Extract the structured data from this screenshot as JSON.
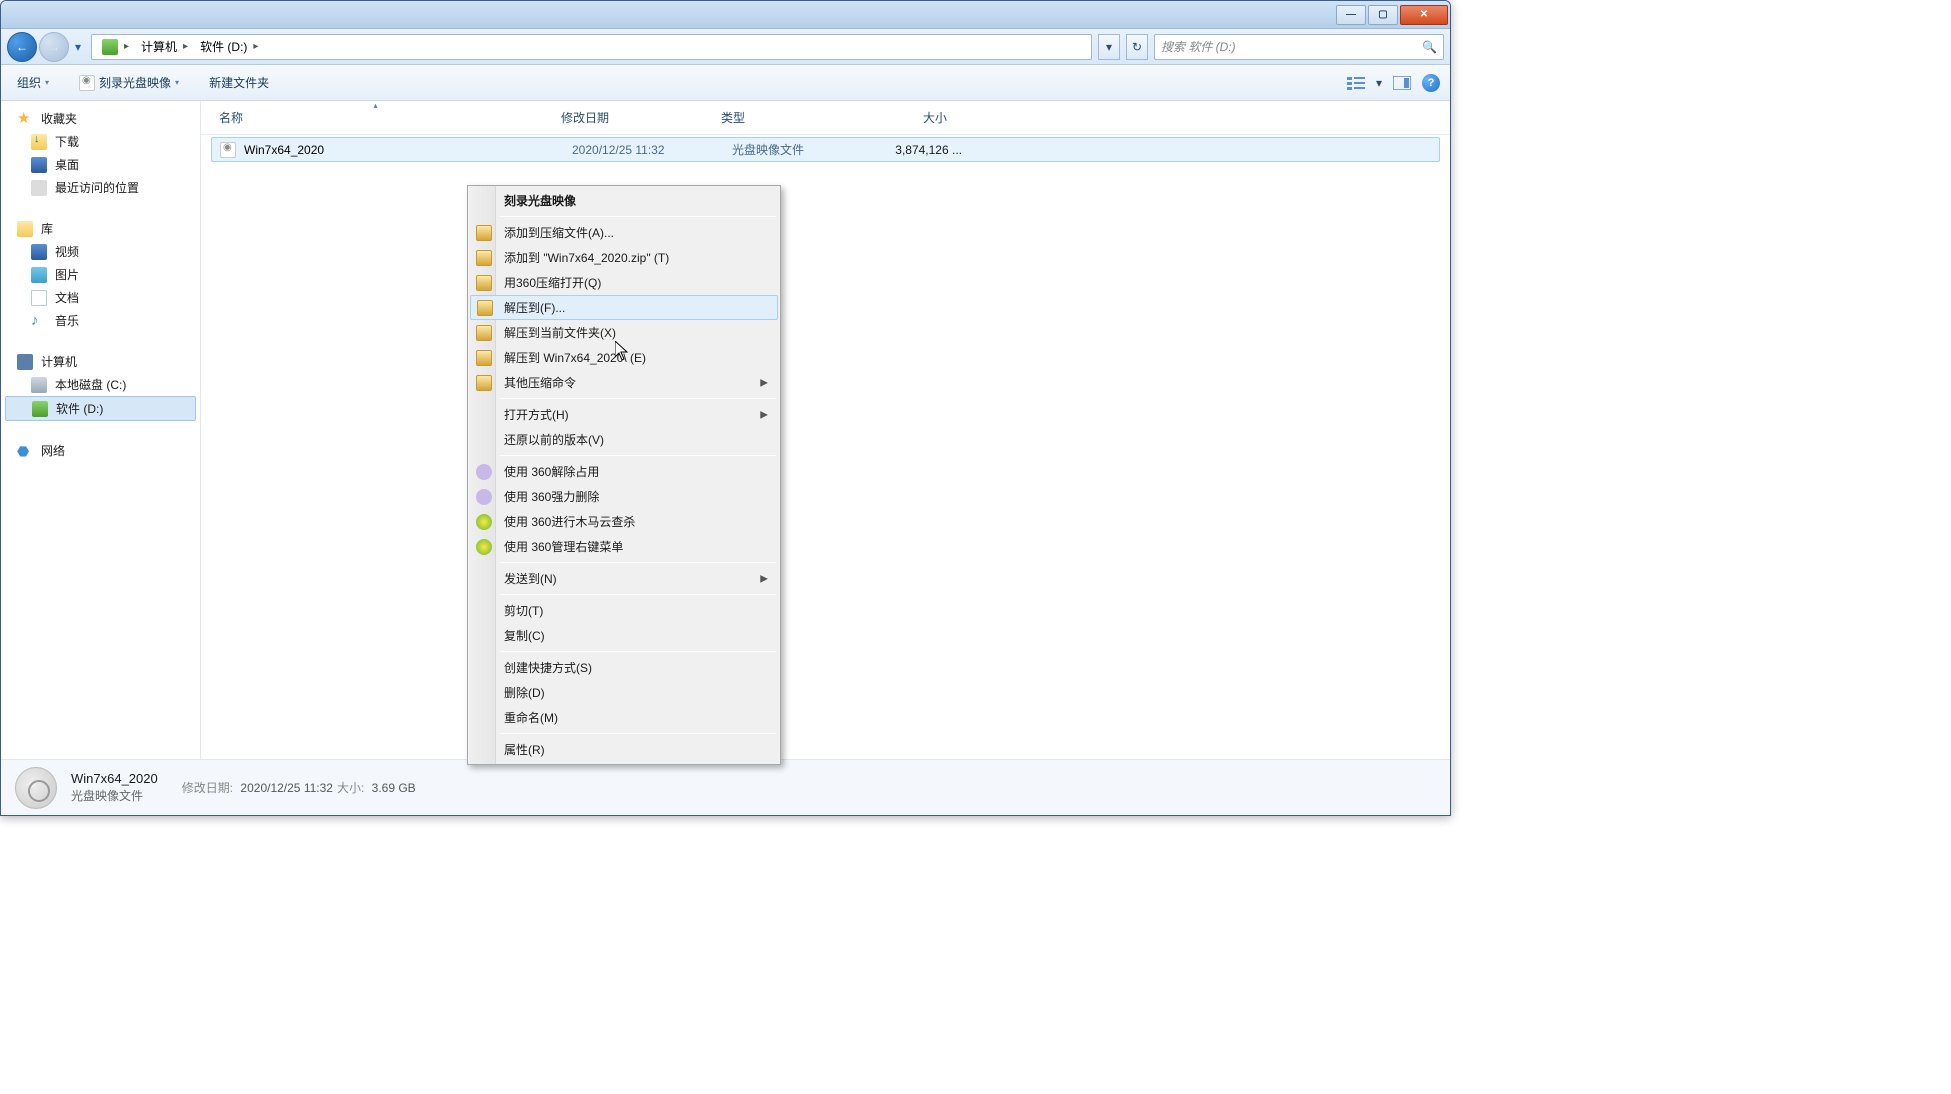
{
  "titlebar": {
    "minimize": "—",
    "maximize": "▢",
    "close": "✕"
  },
  "address": {
    "back_arrow": "←",
    "fwd_arrow": "→",
    "dropdown_arrow": "▾",
    "crumb1": "计算机",
    "sep": "▸",
    "crumb2": "软件 (D:)",
    "address_dropdown": "▾",
    "refresh": "↻",
    "search_placeholder": "搜索 软件 (D:)",
    "search_icon": "🔍"
  },
  "toolbar": {
    "organize": "组织",
    "burn": "刻录光盘映像",
    "newfolder": "新建文件夹",
    "view_arrow": "▾",
    "help": "?"
  },
  "sidebar": {
    "favorites": "收藏夹",
    "downloads": "下载",
    "desktop": "桌面",
    "recent": "最近访问的位置",
    "libraries": "库",
    "videos": "视频",
    "pictures": "图片",
    "documents": "文档",
    "music": "音乐",
    "computer": "计算机",
    "drive_c": "本地磁盘 (C:)",
    "drive_d": "软件 (D:)",
    "network": "网络"
  },
  "columns": {
    "name": "名称",
    "date": "修改日期",
    "type": "类型",
    "size": "大小",
    "sort_indicator": "▴"
  },
  "files": [
    {
      "name": "Win7x64_2020",
      "date": "2020/12/25 11:32",
      "type": "光盘映像文件",
      "size": "3,874,126 ..."
    }
  ],
  "context_menu": {
    "items": [
      {
        "label": "刻录光盘映像",
        "bold": true
      },
      {
        "sep": true
      },
      {
        "label": "添加到压缩文件(A)...",
        "icon": "archive"
      },
      {
        "label": "添加到 \"Win7x64_2020.zip\" (T)",
        "icon": "archive"
      },
      {
        "label": "用360压缩打开(Q)",
        "icon": "archive"
      },
      {
        "label": "解压到(F)...",
        "icon": "archive",
        "highlighted": true
      },
      {
        "label": "解压到当前文件夹(X)",
        "icon": "archive"
      },
      {
        "label": "解压到 Win7x64_2020\\ (E)",
        "icon": "archive"
      },
      {
        "label": "其他压缩命令",
        "icon": "archive",
        "submenu": true
      },
      {
        "sep": true
      },
      {
        "label": "打开方式(H)",
        "submenu": true
      },
      {
        "label": "还原以前的版本(V)"
      },
      {
        "sep": true
      },
      {
        "label": "使用 360解除占用",
        "icon": "360g"
      },
      {
        "label": "使用 360强力删除",
        "icon": "360g"
      },
      {
        "label": "使用 360进行木马云查杀",
        "icon": "360y"
      },
      {
        "label": "使用 360管理右键菜单",
        "icon": "360y"
      },
      {
        "sep": true
      },
      {
        "label": "发送到(N)",
        "submenu": true
      },
      {
        "sep": true
      },
      {
        "label": "剪切(T)"
      },
      {
        "label": "复制(C)"
      },
      {
        "sep": true
      },
      {
        "label": "创建快捷方式(S)"
      },
      {
        "label": "删除(D)"
      },
      {
        "label": "重命名(M)"
      },
      {
        "sep": true
      },
      {
        "label": "属性(R)"
      }
    ]
  },
  "details": {
    "title": "Win7x64_2020",
    "type": "光盘映像文件",
    "date_label": "修改日期:",
    "date_value": "2020/12/25 11:32",
    "size_label": "大小:",
    "size_value": "3.69 GB"
  }
}
